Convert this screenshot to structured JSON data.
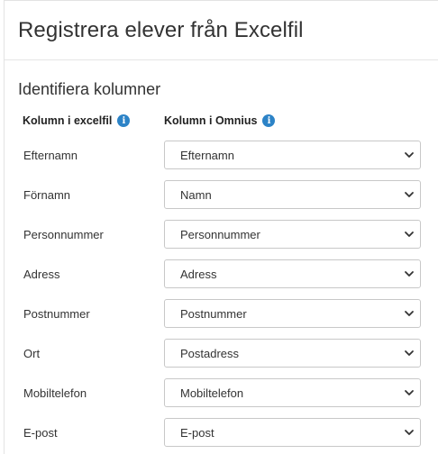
{
  "header": {
    "title": "Registrera elever från Excelfil"
  },
  "section": {
    "title": "Identifiera kolumner"
  },
  "columns": {
    "excel_label": "Kolumn i excelfil",
    "omnius_label": "Kolumn i Omnius",
    "info_glyph": "i"
  },
  "rows": [
    {
      "label": "Efternamn",
      "selected": "Efternamn"
    },
    {
      "label": "Förnamn",
      "selected": "Namn"
    },
    {
      "label": "Personnummer",
      "selected": "Personnummer"
    },
    {
      "label": "Adress",
      "selected": "Adress"
    },
    {
      "label": "Postnummer",
      "selected": "Postnummer"
    },
    {
      "label": "Ort",
      "selected": "Postadress"
    },
    {
      "label": "Mobiltelefon",
      "selected": "Mobiltelefon"
    },
    {
      "label": "E-post",
      "selected": "E-post"
    }
  ],
  "colors": {
    "info_icon": "#2c83c7",
    "border": "#c8c8c8"
  }
}
